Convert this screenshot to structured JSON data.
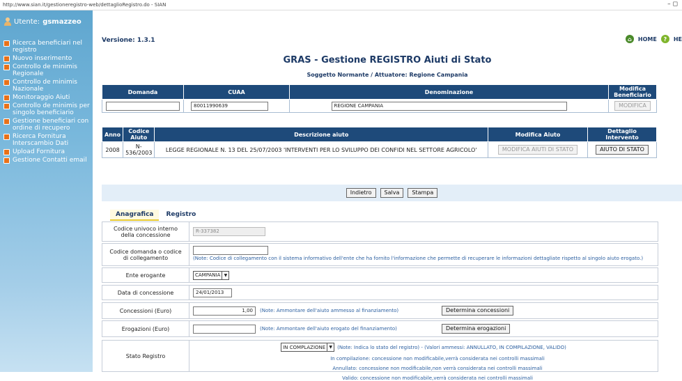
{
  "browser": {
    "url": "http://www.sian.it/gestioneregistro-web/dettaglioRegistro.do - SIAN",
    "controls": "–  ◻"
  },
  "sidebar": {
    "user_label": "Utente:",
    "user_name": "gsmazzeo",
    "items": [
      {
        "label": "Ricerca beneficiari nel registro"
      },
      {
        "label": "Nuovo inserimento"
      },
      {
        "label": "Controllo de minimis Regionale"
      },
      {
        "label": "Controllo de minimis Nazionale"
      },
      {
        "label": "Monitoraggio Aiuti"
      },
      {
        "label": "Controllo de minimis per singolo beneficiario"
      },
      {
        "label": "Gestione beneficiari con ordine di recupero"
      },
      {
        "label": "Ricerca Fornitura Interscambio Dati"
      },
      {
        "label": "Upload Fornitura"
      },
      {
        "label": "Gestione Contatti email"
      }
    ]
  },
  "header": {
    "version": "Versione: 1.3.1",
    "home": "HOME",
    "help": "HE",
    "title": "GRAS - Gestione REGISTRO Aiuti di Stato",
    "subtitle": "Soggetto Normante / Attuatore: Regione Campania"
  },
  "beneficiary_table": {
    "headers": [
      "Domanda",
      "CUAA",
      "Denominazione",
      "Modifica Beneficiario"
    ],
    "domanda": "",
    "cuaa": "80011990639",
    "denominazione": "REGIONE CAMPANIA",
    "button": "MODIFICA"
  },
  "aid_table": {
    "headers": [
      "Anno",
      "Codice Aiuto",
      "Descrizione aiuto",
      "Modifica Aiuto",
      "Dettaglio Intervento"
    ],
    "anno": "2008",
    "codice": "N-536/2003",
    "descrizione": "LEGGE REGIONALE N. 13 DEL 25/07/2003 'INTERVENTI PER LO SVILUPPO DEI CONFIDI NEL SETTORE AGRICOLO'",
    "modifica_button": "MODIFICA AIUTI DI STATO",
    "dettaglio_button": "AIUTO DI STATO"
  },
  "actions": {
    "indietro": "Indietro",
    "salva": "Salva",
    "stampa": "Stampa"
  },
  "tabs": [
    {
      "label": "Anagrafica"
    },
    {
      "label": "Registro"
    }
  ],
  "form": {
    "codice_univoco": {
      "label": "Codice univoco interno della concessione",
      "value": "R-337382"
    },
    "codice_domanda": {
      "label": "Codice domanda o codice di collegamento",
      "value": "",
      "note": "(Note: Codice di collegamento con il sistema informativo dell'ente che ha fornito l'informazione che permette di recuperare le informazioni dettagliate rispetto al singolo aiuto erogato.)"
    },
    "ente": {
      "label": "Ente erogante",
      "value": "CAMPANIA"
    },
    "data": {
      "label": "Data di concessione",
      "value": "24/01/2013"
    },
    "concessioni": {
      "label": "Concessioni (Euro)",
      "value": "1,00",
      "note": "(Note: Ammontare dell'aiuto ammesso al finanziamento)",
      "button": "Determina concessioni"
    },
    "erogazioni": {
      "label": "Erogazioni (Euro)",
      "value": "",
      "note": "(Note: Ammontare dell'aiuto erogato del finanziamento)",
      "button": "Determina erogazioni"
    },
    "stato": {
      "label": "Stato Registro",
      "value": "IN COMPLAZIONE",
      "note": "(Note: Indica lo stato del registro) - (Valori ammessi: ANNULLATO, IN COMPILAZIONE, VALIDO)",
      "line1": "In compilazione: concessione non modificabile,verrà considerata nei controlli massimali",
      "line2": "Annullato: concessione non modificabile,non verrà considerata nei controlli massimali",
      "line3": "Valido: concessione non modificabile,verrà considerata nei controlli massimali"
    }
  }
}
